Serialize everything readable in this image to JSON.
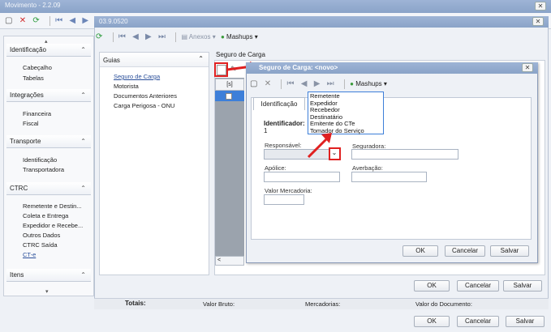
{
  "main_window": {
    "title": "Movimento - 2.2.09"
  },
  "main_toolbar": {
    "icons": [
      "new-icon",
      "delete-icon",
      "refresh-icon",
      "first-icon",
      "prev-icon",
      "next-icon"
    ]
  },
  "inner_window": {
    "title": "03.9.0520"
  },
  "inner_toolbar": {
    "anexos": "Anexos",
    "mashups": "Mashups"
  },
  "sidebar": {
    "sections": [
      {
        "label": "Identificação",
        "items": [
          "Cabeçalho",
          "Tabelas"
        ]
      },
      {
        "label": "Integrações",
        "items": [
          "Financeira",
          "Fiscal"
        ]
      },
      {
        "label": "Transporte",
        "items": [
          "Identificação",
          "Transportadora"
        ]
      },
      {
        "label": "CTRC",
        "items": [
          "Remetente e Destin...",
          "Coleta e Entrega",
          "Expedidor e Recebe...",
          "Outros Dados",
          "CTRC Saída",
          "CT-e"
        ]
      },
      {
        "label": "Itens",
        "items": []
      }
    ]
  },
  "guias": {
    "header": "Guias",
    "items": [
      "Seguro de Carga",
      "Motorista",
      "Documentos Anteriores",
      "Carga Perigosa - ONU"
    ]
  },
  "seguro_section": {
    "label": "Seguro de Carga"
  },
  "grid": {
    "header_mark": "[s]"
  },
  "dialog": {
    "title": "Seguro de Carga: <novo>",
    "mashups": "Mashups",
    "tab": "Identificação",
    "identificador_label": "Identificador:",
    "identificador_value": "1",
    "responsavel_label": "Responsável:",
    "seguradora_label": "Seguradora:",
    "apolice_label": "Apólice:",
    "averbacao_label": "Averbação:",
    "valor_label": "Valor Mercadoria:",
    "ok": "OK",
    "cancel": "Cancelar",
    "save": "Salvar"
  },
  "dropdown": {
    "options": [
      "Remetente",
      "Expedidor",
      "Recebedor",
      "Destinatário",
      "Emitente do CTe",
      "Tomador do Serviço"
    ]
  },
  "inner_buttons": {
    "ok": "OK",
    "cancel": "Cancelar",
    "save": "Salvar"
  },
  "totals": {
    "totais": "Totais:",
    "valor_bruto": "Valor Bruto:",
    "mercadorias": "Mercadorias:",
    "valor_documento": "Valor do Documento:"
  },
  "outer_buttons": {
    "ok": "OK",
    "cancel": "Cancelar",
    "save": "Salvar"
  },
  "colors": {
    "accent_red": "#e02020",
    "titlebar": "#8aa3c8",
    "selection_blue": "#3d7fd9"
  }
}
